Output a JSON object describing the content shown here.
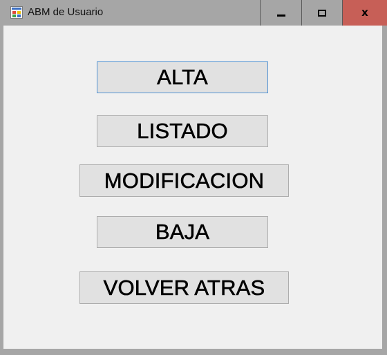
{
  "window": {
    "title": "ABM de Usuario",
    "icon": "winforms-app-icon",
    "controls": {
      "minimize_icon": "minimize-icon",
      "maximize_icon": "maximize-icon",
      "close_label": "x"
    },
    "colors": {
      "titlebar": "#a6a6a6",
      "close_hover": "#c75f57",
      "client_bg": "#f0f0f0",
      "button_bg": "#e1e1e1",
      "focus_border": "#4d8fd2"
    }
  },
  "buttons": {
    "alta": "ALTA",
    "listado": "LISTADO",
    "modificacion": "MODIFICACION",
    "baja": "BAJA",
    "volver": "VOLVER ATRAS"
  }
}
